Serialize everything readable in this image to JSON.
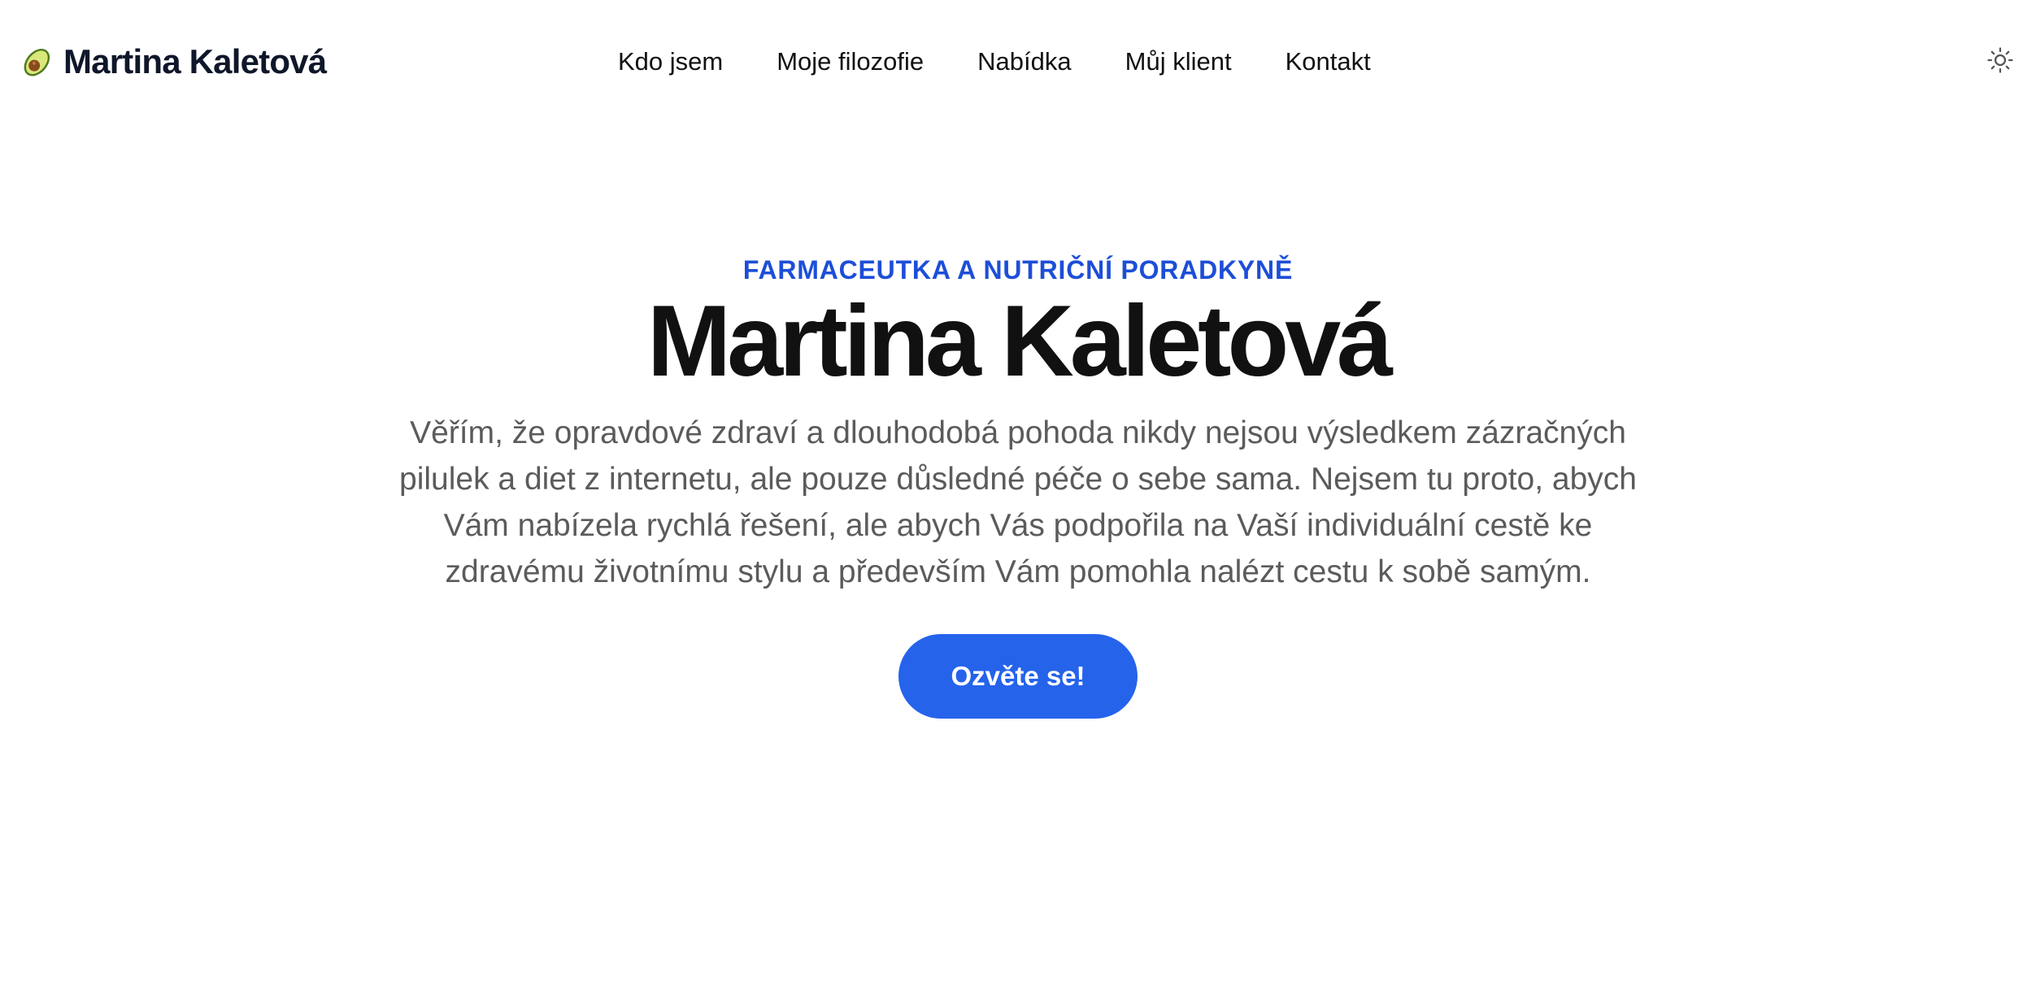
{
  "header": {
    "brand_name": "Martina Kaletová",
    "brand_icon": "avocado-icon",
    "nav": [
      {
        "label": "Kdo jsem"
      },
      {
        "label": "Moje filozofie"
      },
      {
        "label": "Nabídka"
      },
      {
        "label": "Můj klient"
      },
      {
        "label": "Kontakt"
      }
    ],
    "theme_toggle_icon": "sun-icon"
  },
  "hero": {
    "eyebrow": "FARMACEUTKA A NUTRIČNÍ PORADKYNĚ",
    "title": "Martina Kaletová",
    "text": "Věřím, že opravdové zdraví a dlouhodobá pohoda nikdy nejsou výsledkem zázračných pilulek a diet z internetu, ale pouze důsledné péče o sebe sama. Nejsem tu proto, abych Vám nabízela rychlá řešení, ale abych Vás podpořila na Vaší individuální cestě ke zdravému životnímu stylu a především Vám pomohla nalézt cestu k sobě samým.",
    "cta_label": "Ozvěte se!"
  },
  "colors": {
    "accent": "#2563eb",
    "eyebrow": "#1d4ed8",
    "heading": "#111111",
    "body_text": "#5b5b5b",
    "background": "#ffffff"
  }
}
